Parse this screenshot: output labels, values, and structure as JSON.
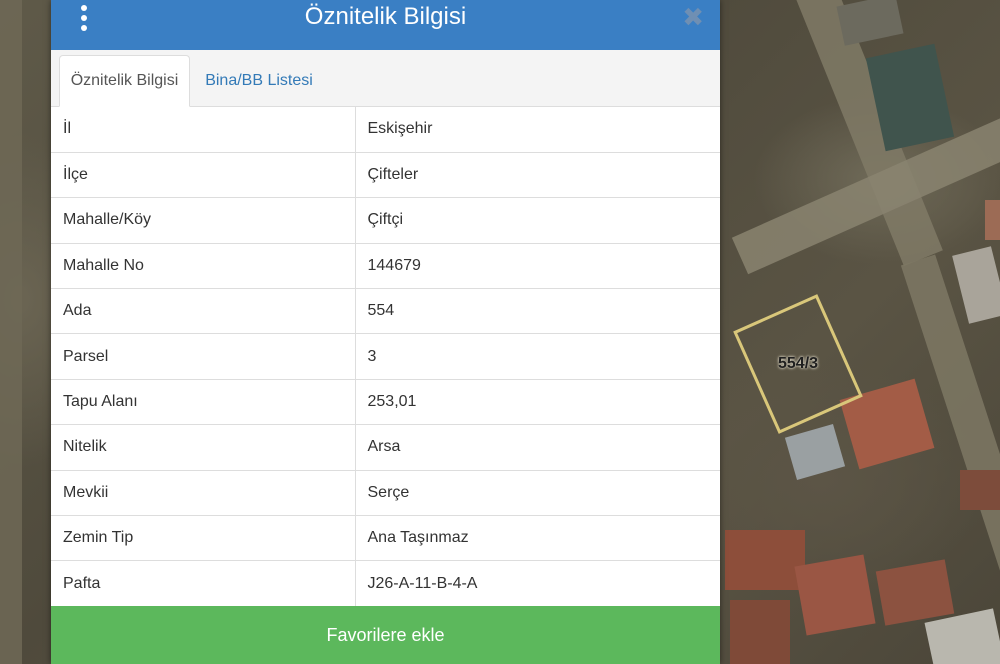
{
  "map": {
    "parcel_label": "554/3",
    "parcel_border_color": "#d9c77a"
  },
  "panel": {
    "title": "Öznitelik Bilgisi",
    "header_color": "#3a7fc4",
    "menu_icon": "kebab-menu-icon",
    "close_icon": "close-icon",
    "close_glyph": "✖"
  },
  "tabs": [
    {
      "label": "Öznitelik Bilgisi",
      "active": true
    },
    {
      "label": "Bina/BB Listesi",
      "active": false
    }
  ],
  "attributes": [
    {
      "key": "İl",
      "value": "Eskişehir"
    },
    {
      "key": "İlçe",
      "value": "Çifteler"
    },
    {
      "key": "Mahalle/Köy",
      "value": "Çiftçi"
    },
    {
      "key": "Mahalle No",
      "value": "144679"
    },
    {
      "key": "Ada",
      "value": "554"
    },
    {
      "key": "Parsel",
      "value": "3"
    },
    {
      "key": "Tapu Alanı",
      "value": "253,01"
    },
    {
      "key": "Nitelik",
      "value": "Arsa"
    },
    {
      "key": "Mevkii",
      "value": "Serçe"
    },
    {
      "key": "Zemin Tip",
      "value": "Ana Taşınmaz"
    },
    {
      "key": "Pafta",
      "value": "J26-A-11-B-4-A"
    }
  ],
  "footer": {
    "favorite_label": "Favorilere ekle",
    "button_color": "#5cb85c"
  }
}
